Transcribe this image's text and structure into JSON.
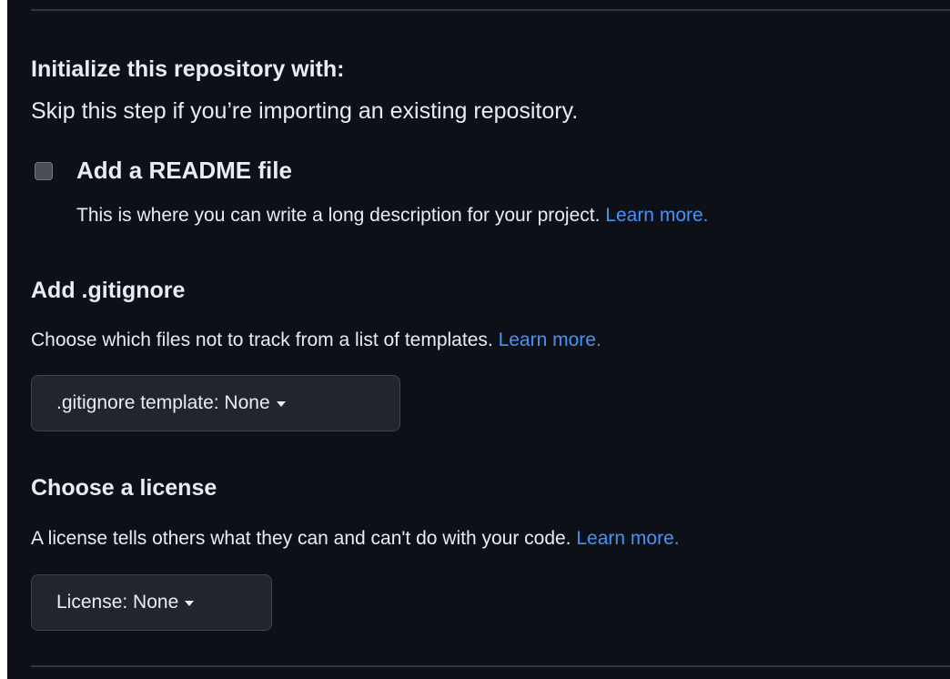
{
  "initialize": {
    "heading": "Initialize this repository with:",
    "subtitle": "Skip this step if you’re importing an existing repository."
  },
  "readme": {
    "checked": false,
    "label": "Add a README file",
    "description": "This is where you can write a long description for your project.",
    "learn_more": "Learn more."
  },
  "gitignore": {
    "heading": "Add .gitignore",
    "description": "Choose which files not to track from a list of templates.",
    "learn_more": "Learn more.",
    "select_label": ".gitignore template: None"
  },
  "license": {
    "heading": "Choose a license",
    "description": "A license tells others what they can and can't do with your code.",
    "learn_more": "Learn more.",
    "select_label": "License: None"
  },
  "colors": {
    "background": "#0d1117",
    "text": "#e6edf3",
    "link": "#4493f8",
    "button_bg": "#21262d",
    "border": "#3d444d"
  },
  "icons": {
    "dropdown": "caret-down-icon",
    "checkbox": "checkbox-icon"
  }
}
